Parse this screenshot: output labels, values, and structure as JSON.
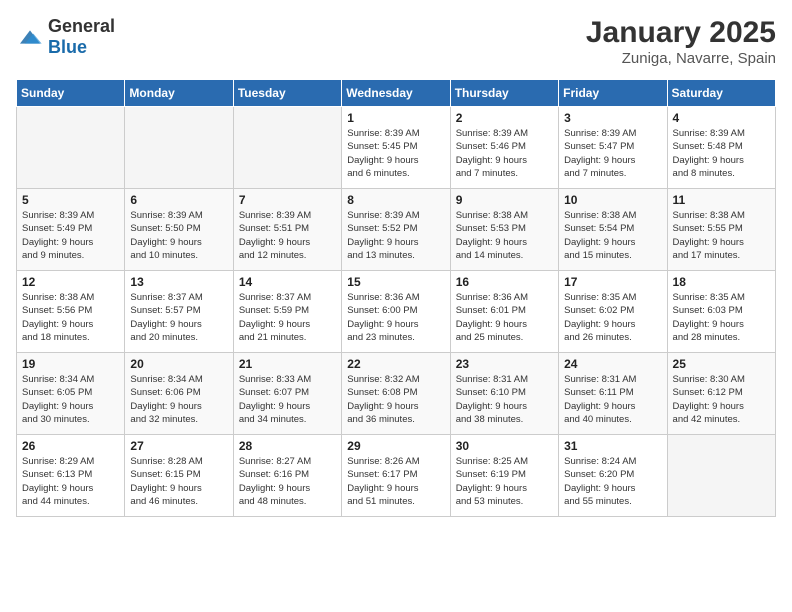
{
  "logo": {
    "general": "General",
    "blue": "Blue"
  },
  "header": {
    "title": "January 2025",
    "subtitle": "Zuniga, Navarre, Spain"
  },
  "weekdays": [
    "Sunday",
    "Monday",
    "Tuesday",
    "Wednesday",
    "Thursday",
    "Friday",
    "Saturday"
  ],
  "weeks": [
    [
      {
        "day": "",
        "info": "",
        "empty": true
      },
      {
        "day": "",
        "info": "",
        "empty": true
      },
      {
        "day": "",
        "info": "",
        "empty": true
      },
      {
        "day": "1",
        "info": "Sunrise: 8:39 AM\nSunset: 5:45 PM\nDaylight: 9 hours\nand 6 minutes.",
        "empty": false
      },
      {
        "day": "2",
        "info": "Sunrise: 8:39 AM\nSunset: 5:46 PM\nDaylight: 9 hours\nand 7 minutes.",
        "empty": false
      },
      {
        "day": "3",
        "info": "Sunrise: 8:39 AM\nSunset: 5:47 PM\nDaylight: 9 hours\nand 7 minutes.",
        "empty": false
      },
      {
        "day": "4",
        "info": "Sunrise: 8:39 AM\nSunset: 5:48 PM\nDaylight: 9 hours\nand 8 minutes.",
        "empty": false
      }
    ],
    [
      {
        "day": "5",
        "info": "Sunrise: 8:39 AM\nSunset: 5:49 PM\nDaylight: 9 hours\nand 9 minutes.",
        "empty": false
      },
      {
        "day": "6",
        "info": "Sunrise: 8:39 AM\nSunset: 5:50 PM\nDaylight: 9 hours\nand 10 minutes.",
        "empty": false
      },
      {
        "day": "7",
        "info": "Sunrise: 8:39 AM\nSunset: 5:51 PM\nDaylight: 9 hours\nand 12 minutes.",
        "empty": false
      },
      {
        "day": "8",
        "info": "Sunrise: 8:39 AM\nSunset: 5:52 PM\nDaylight: 9 hours\nand 13 minutes.",
        "empty": false
      },
      {
        "day": "9",
        "info": "Sunrise: 8:38 AM\nSunset: 5:53 PM\nDaylight: 9 hours\nand 14 minutes.",
        "empty": false
      },
      {
        "day": "10",
        "info": "Sunrise: 8:38 AM\nSunset: 5:54 PM\nDaylight: 9 hours\nand 15 minutes.",
        "empty": false
      },
      {
        "day": "11",
        "info": "Sunrise: 8:38 AM\nSunset: 5:55 PM\nDaylight: 9 hours\nand 17 minutes.",
        "empty": false
      }
    ],
    [
      {
        "day": "12",
        "info": "Sunrise: 8:38 AM\nSunset: 5:56 PM\nDaylight: 9 hours\nand 18 minutes.",
        "empty": false
      },
      {
        "day": "13",
        "info": "Sunrise: 8:37 AM\nSunset: 5:57 PM\nDaylight: 9 hours\nand 20 minutes.",
        "empty": false
      },
      {
        "day": "14",
        "info": "Sunrise: 8:37 AM\nSunset: 5:59 PM\nDaylight: 9 hours\nand 21 minutes.",
        "empty": false
      },
      {
        "day": "15",
        "info": "Sunrise: 8:36 AM\nSunset: 6:00 PM\nDaylight: 9 hours\nand 23 minutes.",
        "empty": false
      },
      {
        "day": "16",
        "info": "Sunrise: 8:36 AM\nSunset: 6:01 PM\nDaylight: 9 hours\nand 25 minutes.",
        "empty": false
      },
      {
        "day": "17",
        "info": "Sunrise: 8:35 AM\nSunset: 6:02 PM\nDaylight: 9 hours\nand 26 minutes.",
        "empty": false
      },
      {
        "day": "18",
        "info": "Sunrise: 8:35 AM\nSunset: 6:03 PM\nDaylight: 9 hours\nand 28 minutes.",
        "empty": false
      }
    ],
    [
      {
        "day": "19",
        "info": "Sunrise: 8:34 AM\nSunset: 6:05 PM\nDaylight: 9 hours\nand 30 minutes.",
        "empty": false
      },
      {
        "day": "20",
        "info": "Sunrise: 8:34 AM\nSunset: 6:06 PM\nDaylight: 9 hours\nand 32 minutes.",
        "empty": false
      },
      {
        "day": "21",
        "info": "Sunrise: 8:33 AM\nSunset: 6:07 PM\nDaylight: 9 hours\nand 34 minutes.",
        "empty": false
      },
      {
        "day": "22",
        "info": "Sunrise: 8:32 AM\nSunset: 6:08 PM\nDaylight: 9 hours\nand 36 minutes.",
        "empty": false
      },
      {
        "day": "23",
        "info": "Sunrise: 8:31 AM\nSunset: 6:10 PM\nDaylight: 9 hours\nand 38 minutes.",
        "empty": false
      },
      {
        "day": "24",
        "info": "Sunrise: 8:31 AM\nSunset: 6:11 PM\nDaylight: 9 hours\nand 40 minutes.",
        "empty": false
      },
      {
        "day": "25",
        "info": "Sunrise: 8:30 AM\nSunset: 6:12 PM\nDaylight: 9 hours\nand 42 minutes.",
        "empty": false
      }
    ],
    [
      {
        "day": "26",
        "info": "Sunrise: 8:29 AM\nSunset: 6:13 PM\nDaylight: 9 hours\nand 44 minutes.",
        "empty": false
      },
      {
        "day": "27",
        "info": "Sunrise: 8:28 AM\nSunset: 6:15 PM\nDaylight: 9 hours\nand 46 minutes.",
        "empty": false
      },
      {
        "day": "28",
        "info": "Sunrise: 8:27 AM\nSunset: 6:16 PM\nDaylight: 9 hours\nand 48 minutes.",
        "empty": false
      },
      {
        "day": "29",
        "info": "Sunrise: 8:26 AM\nSunset: 6:17 PM\nDaylight: 9 hours\nand 51 minutes.",
        "empty": false
      },
      {
        "day": "30",
        "info": "Sunrise: 8:25 AM\nSunset: 6:19 PM\nDaylight: 9 hours\nand 53 minutes.",
        "empty": false
      },
      {
        "day": "31",
        "info": "Sunrise: 8:24 AM\nSunset: 6:20 PM\nDaylight: 9 hours\nand 55 minutes.",
        "empty": false
      },
      {
        "day": "",
        "info": "",
        "empty": true
      }
    ]
  ]
}
